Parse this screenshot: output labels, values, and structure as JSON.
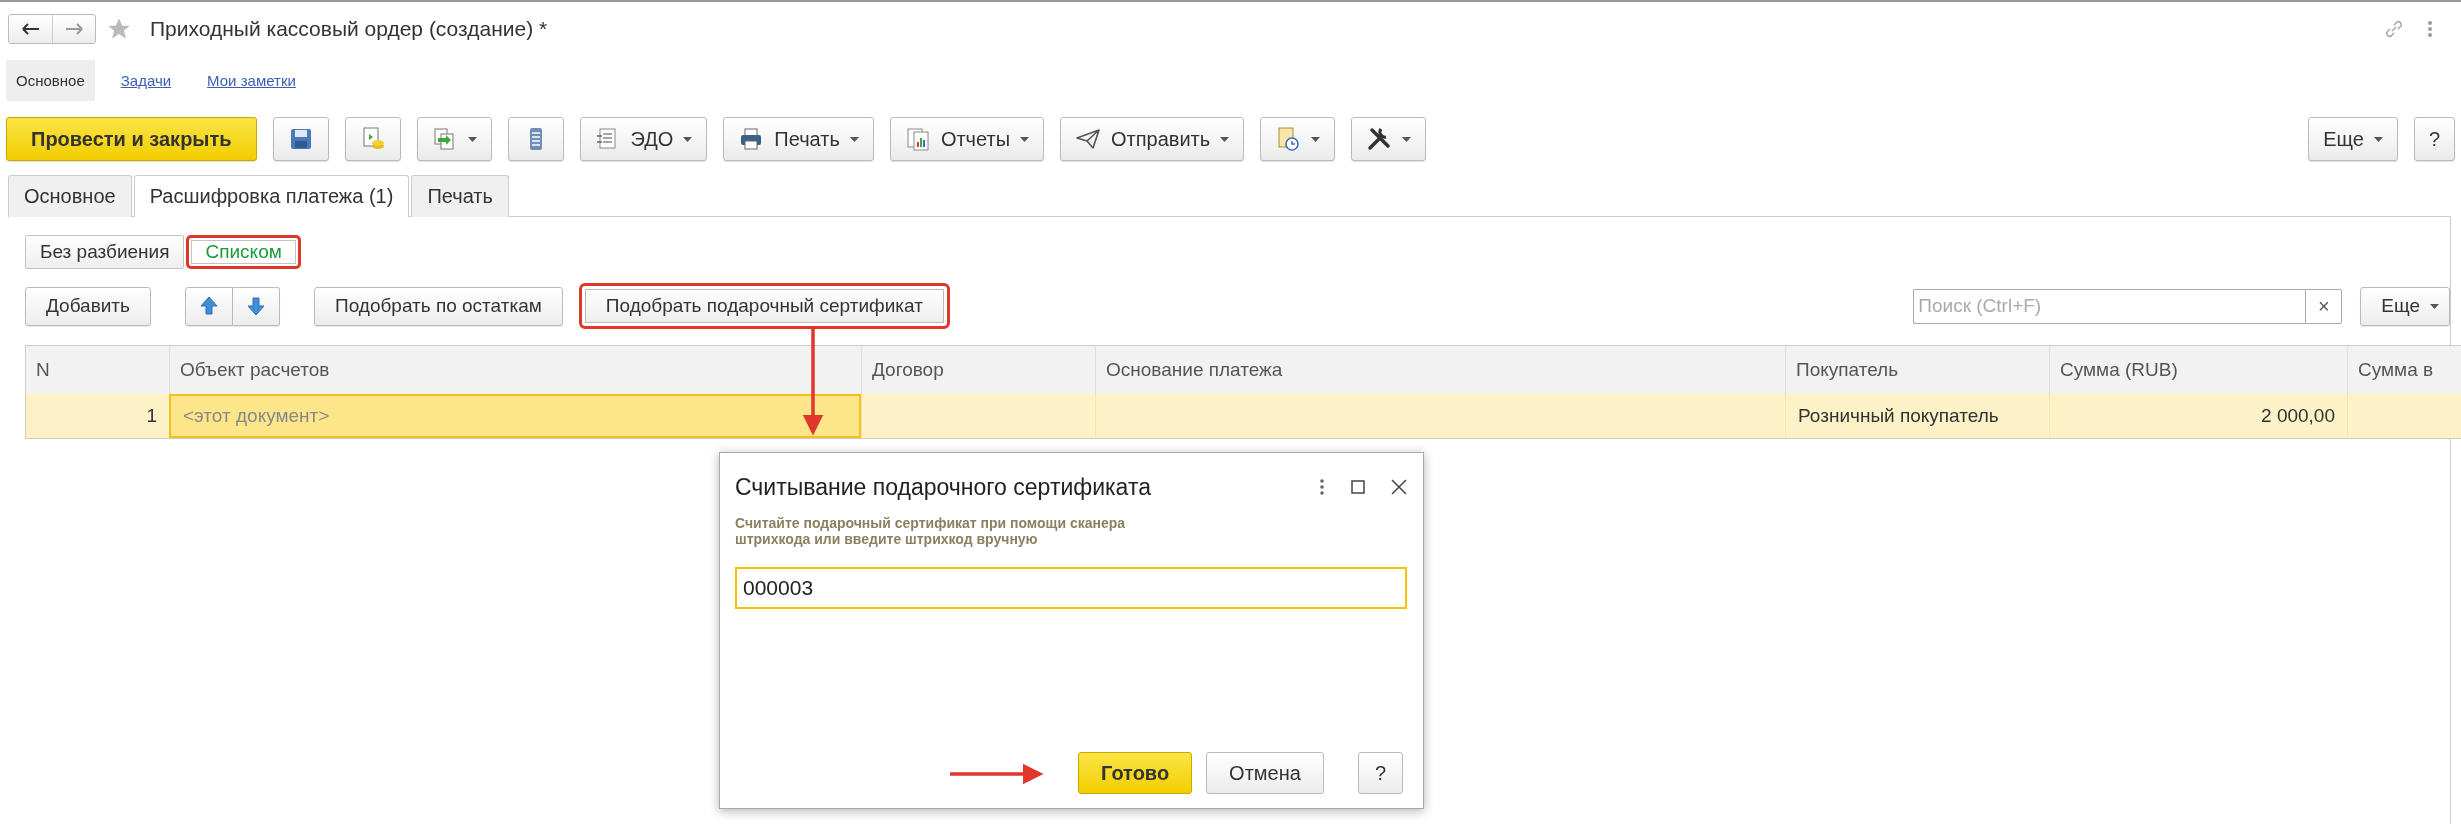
{
  "window": {
    "title": "Приходный кассовый ордер (создание) *"
  },
  "nav": [
    {
      "label": "Основное",
      "selected": true
    },
    {
      "label": "Задачи",
      "selected": false
    },
    {
      "label": "Мои заметки",
      "selected": false
    }
  ],
  "toolbar": [
    {
      "kind": "primary",
      "label": "Провести и закрыть",
      "dropdown": false
    },
    {
      "kind": "save",
      "dropdown": false
    },
    {
      "kind": "post",
      "dropdown": false
    },
    {
      "kind": "create",
      "dropdown": true
    },
    {
      "kind": "register",
      "dropdown": false
    },
    {
      "kind": "edo",
      "label": "ЭДО",
      "dropdown": true
    },
    {
      "kind": "print",
      "label": "Печать",
      "dropdown": true
    },
    {
      "kind": "reports",
      "label": "Отчеты",
      "dropdown": true
    },
    {
      "kind": "send",
      "label": "Отправить",
      "dropdown": true
    },
    {
      "kind": "attach",
      "dropdown": true
    },
    {
      "kind": "tools",
      "dropdown": true
    }
  ],
  "toolbar_right": {
    "more": "Еще",
    "help": "?"
  },
  "tabs": [
    {
      "label": "Основное",
      "selected": false
    },
    {
      "label": "Расшифровка платежа (1)",
      "selected": true
    },
    {
      "label": "Печать",
      "selected": false
    }
  ],
  "view_switch": [
    {
      "label": "Без разбиения",
      "selected": false,
      "highlighted": false
    },
    {
      "label": "Списком",
      "selected": true,
      "highlighted": true
    }
  ],
  "actions": [
    {
      "kind": "text",
      "label": "Добавить",
      "highlighted": false
    },
    {
      "kind": "up",
      "highlighted": false
    },
    {
      "kind": "down",
      "highlighted": false
    },
    {
      "kind": "text",
      "label": "Подобрать по остаткам",
      "highlighted": false
    },
    {
      "kind": "text",
      "label": "Подобрать подарочный сертификат",
      "highlighted": true
    }
  ],
  "search": {
    "placeholder": "Поиск (Ctrl+F)",
    "clear": "×"
  },
  "table_more": "Еще",
  "table": {
    "columns": [
      "N",
      "Объект расчетов",
      "Договор",
      "Основание платежа",
      "Покупатель",
      "Сумма (RUB)",
      "Сумма в"
    ],
    "rows": [
      {
        "selected": true,
        "n": "1",
        "object": {
          "text": "<этот документ>",
          "focused": true
        },
        "buyer": "Розничный покупатель",
        "amount": "2 000,00"
      }
    ]
  },
  "dialog": {
    "title": "Считывание подарочного сертификата",
    "hint": "Считайте подарочный сертификат при помощи сканера штрихкода или введите штрихкод вручную",
    "value": "000003",
    "buttons": [
      {
        "kind": "primary",
        "label": "Готово"
      },
      {
        "kind": "default",
        "label": "Отмена"
      },
      {
        "kind": "help",
        "label": "?"
      }
    ]
  }
}
